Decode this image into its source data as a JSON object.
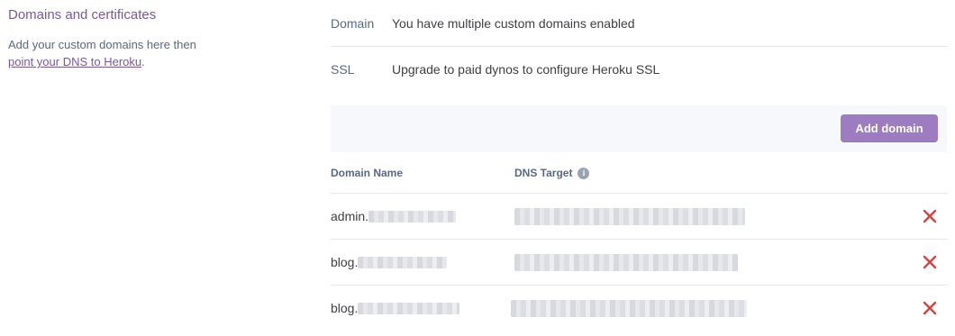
{
  "left": {
    "title": "Domains and certificates",
    "description_prefix": "Add your custom domains here then",
    "link_text": "point your DNS to Heroku",
    "description_suffix": "."
  },
  "info": {
    "domain_label": "Domain",
    "domain_value": "You have multiple custom domains enabled",
    "ssl_label": "SSL",
    "ssl_value": "Upgrade to paid dynos to configure Heroku SSL"
  },
  "toolbar": {
    "add_domain_label": "Add domain"
  },
  "table": {
    "columns": [
      "Domain Name",
      "DNS Target"
    ],
    "rows": [
      {
        "domain_prefix": "admin.",
        "dns_target": ""
      },
      {
        "domain_prefix": "blog.",
        "dns_target": ""
      },
      {
        "domain_prefix": "blog.",
        "dns_target": ""
      }
    ]
  },
  "icons": {
    "info": "info-icon",
    "delete": "close-icon"
  },
  "colors": {
    "accent": "#79589f",
    "button": "#9e7cc1",
    "delete": "#d64242",
    "muted": "#596981"
  }
}
